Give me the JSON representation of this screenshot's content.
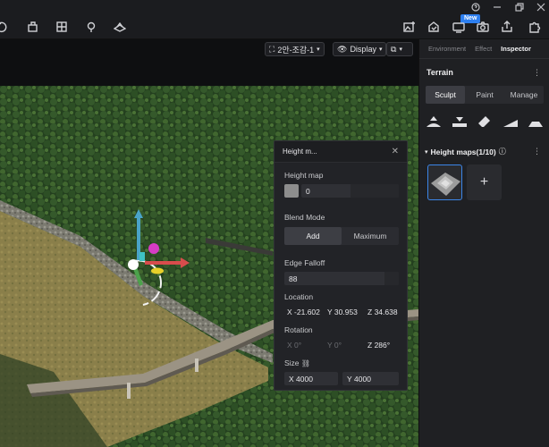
{
  "toolbar": {
    "badge": "New",
    "icons": [
      "undo-icon",
      "bucket-icon",
      "grid-icon",
      "pin-icon",
      "shape-icon",
      "image-edit-icon",
      "save-icon",
      "monitor-icon",
      "camera-icon",
      "share-icon",
      "help-icon",
      "minimize-icon",
      "restore-icon",
      "close-icon"
    ]
  },
  "viewport": {
    "camera_select": "2안-조감-1",
    "display_label": "Display"
  },
  "inspector": {
    "tabs": [
      "Environment",
      "Effect",
      "Inspector"
    ],
    "active_tab": "Inspector",
    "section_title": "Terrain",
    "mode_tabs": [
      "Sculpt",
      "Paint",
      "Manage"
    ],
    "active_mode": "Sculpt",
    "heightmaps_title": "Height maps(1/10)",
    "add_label": "+"
  },
  "dialog": {
    "title": "Height m...",
    "height_map_label": "Height map",
    "height_map_value": "0",
    "blend_mode_label": "Blend Mode",
    "blend_options": [
      "Add",
      "Maximum"
    ],
    "blend_selected": "Add",
    "edge_falloff_label": "Edge Falloff",
    "edge_falloff_value": "88",
    "location_label": "Location",
    "location": {
      "x": "-21.602",
      "y": "30.953",
      "z": "34.638"
    },
    "rotation_label": "Rotation",
    "rotation": {
      "x": "0°",
      "y": "0°",
      "z": "286°"
    },
    "size_label": "Size",
    "size": {
      "x": "4000",
      "y": "4000"
    },
    "axis": {
      "x": "X",
      "y": "Y",
      "z": "Z"
    }
  },
  "colors": {
    "accent": "#2d7ff0",
    "panel": "#1f2023",
    "dialog": "#222327"
  }
}
